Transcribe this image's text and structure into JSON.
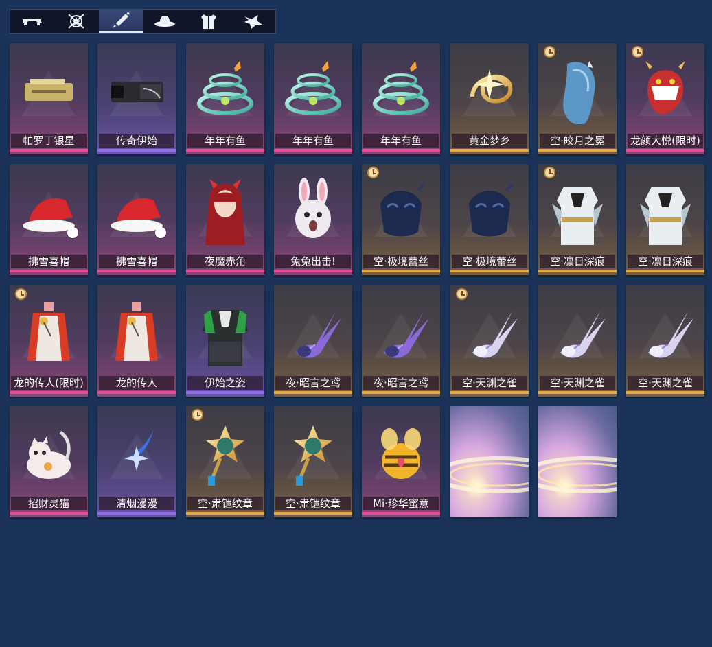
{
  "tabs": [
    {
      "icon": "vehicle-icon",
      "active": false
    },
    {
      "icon": "emblem-icon",
      "active": false
    },
    {
      "icon": "weapon-icon",
      "active": true
    },
    {
      "icon": "hat-icon",
      "active": false
    },
    {
      "icon": "outfit-icon",
      "active": false
    },
    {
      "icon": "pet-icon",
      "active": false
    }
  ],
  "items": [
    {
      "label": "帕罗丁银星",
      "rarity": "pink",
      "timed": false,
      "art": "gun-gold"
    },
    {
      "label": "传奇伊始",
      "rarity": "purple",
      "timed": false,
      "art": "gun-dark"
    },
    {
      "label": "年年有鱼",
      "rarity": "pink",
      "timed": false,
      "art": "fish-swirl"
    },
    {
      "label": "年年有鱼",
      "rarity": "pink",
      "timed": false,
      "art": "fish-swirl"
    },
    {
      "label": "年年有鱼",
      "rarity": "pink",
      "timed": false,
      "art": "fish-swirl"
    },
    {
      "label": "黄金梦乡",
      "rarity": "gold",
      "timed": false,
      "art": "gold-swirl"
    },
    {
      "label": "空·皎月之冕",
      "rarity": "gold",
      "timed": true,
      "art": "blue-hair"
    },
    {
      "label": "龙颜大悦(限时)",
      "rarity": "pink",
      "timed": true,
      "art": "dragon-mask"
    },
    {
      "label": "拂雪喜帽",
      "rarity": "pink",
      "timed": false,
      "art": "santa-hat"
    },
    {
      "label": "拂雪喜帽",
      "rarity": "pink",
      "timed": false,
      "art": "santa-hat"
    },
    {
      "label": "夜魔赤角",
      "rarity": "pink",
      "timed": false,
      "art": "red-hair"
    },
    {
      "label": "兔兔出击!",
      "rarity": "pink",
      "timed": false,
      "art": "bunny"
    },
    {
      "label": "空·极境蕾丝",
      "rarity": "gold",
      "timed": true,
      "art": "mask"
    },
    {
      "label": "空·极境蕾丝",
      "rarity": "gold",
      "timed": false,
      "art": "mask"
    },
    {
      "label": "空·凛日深痕",
      "rarity": "gold",
      "timed": true,
      "art": "white-outfit"
    },
    {
      "label": "空·凛日深痕",
      "rarity": "gold",
      "timed": false,
      "art": "white-outfit"
    },
    {
      "label": "龙的传人(限时)",
      "rarity": "pink",
      "timed": true,
      "art": "red-robe"
    },
    {
      "label": "龙的传人",
      "rarity": "pink",
      "timed": false,
      "art": "red-robe"
    },
    {
      "label": "伊始之姿",
      "rarity": "purple",
      "timed": false,
      "art": "green-outfit"
    },
    {
      "label": "夜·昭言之鸢",
      "rarity": "gold",
      "timed": false,
      "art": "purple-bird"
    },
    {
      "label": "夜·昭言之鸢",
      "rarity": "gold",
      "timed": false,
      "art": "purple-bird"
    },
    {
      "label": "空·天渊之雀",
      "rarity": "gold",
      "timed": true,
      "art": "white-bird"
    },
    {
      "label": "空·天渊之雀",
      "rarity": "gold",
      "timed": false,
      "art": "white-bird"
    },
    {
      "label": "空·天渊之雀",
      "rarity": "gold",
      "timed": false,
      "art": "white-bird"
    },
    {
      "label": "招财灵猫",
      "rarity": "pink",
      "timed": false,
      "art": "lucky-cat"
    },
    {
      "label": "清烟漫漫",
      "rarity": "purple",
      "timed": false,
      "art": "blue-spark"
    },
    {
      "label": "空·肃铠纹章",
      "rarity": "gold",
      "timed": true,
      "art": "badge"
    },
    {
      "label": "空·肃铠纹章",
      "rarity": "gold",
      "timed": false,
      "art": "badge"
    },
    {
      "label": "Mi·珍华蜜意",
      "rarity": "pink",
      "timed": false,
      "art": "bee"
    },
    {
      "label": "",
      "rarity": "glow",
      "timed": false,
      "art": "glow"
    },
    {
      "label": "",
      "rarity": "glow",
      "timed": false,
      "art": "glow"
    }
  ],
  "colors": {
    "background": "#1b3358",
    "pink": "#e0509a",
    "purple": "#8f6cf0",
    "gold": "#e6a84a"
  }
}
